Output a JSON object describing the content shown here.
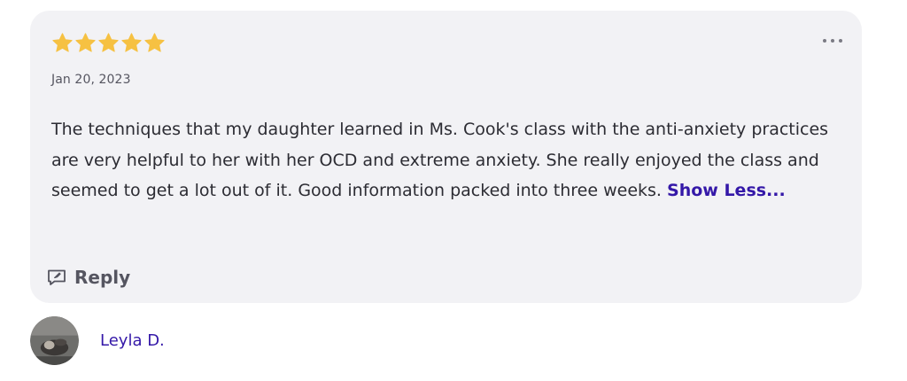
{
  "review": {
    "rating": 5,
    "date": "Jan 20, 2023",
    "body": "The techniques that my daughter learned in Ms. Cook's class with the anti-anxiety practices are very helpful to her with her OCD and extreme anxiety. She really enjoyed the class and seemed to get a lot out of it. Good information packed into three weeks.",
    "show_less_label": "Show Less...",
    "more_icon": "more-horizontal-icon",
    "reply_label": "Reply",
    "reply_icon": "reply-chat-icon"
  },
  "author": {
    "name": "Leyla D.",
    "avatar_icon": "user-avatar"
  },
  "colors": {
    "star": "#f6c142",
    "accent": "#3418a8",
    "card_bg": "#f2f2f5",
    "text": "#2c2c33",
    "muted": "#555560"
  }
}
